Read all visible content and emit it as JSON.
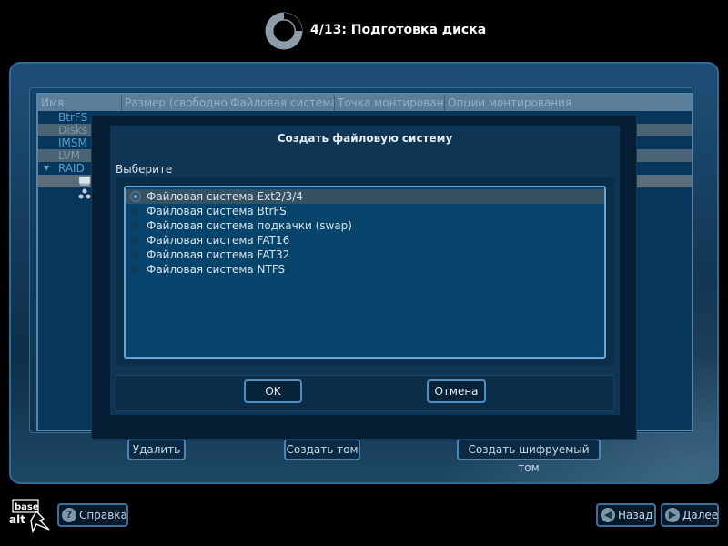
{
  "header": {
    "title": "4/13: Подготовка диска",
    "logo_icon": "basealt-ring-logo"
  },
  "table": {
    "columns": [
      "Имя",
      "Размер (свободно)",
      "Файловая система",
      "Точка монтирования",
      "Опции монтирования"
    ],
    "tree": [
      "BtrFS",
      "Disks",
      "IMSM",
      "LVM",
      "RAID"
    ]
  },
  "panel_buttons": {
    "delete": "Удалить",
    "create_volume": "Создать том",
    "create_encrypted": "Создать шифруемый том"
  },
  "dialog": {
    "title": "Создать файловую систему",
    "prompt": "Выберите",
    "options": [
      "Файловая система Ext2/3/4",
      "Файловая система BtrFS",
      "Файловая система подкачки (swap)",
      "Файловая система FAT16",
      "Файловая система FAT32",
      "Файловая система NTFS"
    ],
    "selected_index": 0,
    "ok": "OK",
    "cancel": "Отмена"
  },
  "bottom": {
    "help": "Справка",
    "back": "Назад",
    "next": "Далее",
    "brand_top": "base",
    "brand_bottom": "alt"
  },
  "colors": {
    "accent_border": "#4a90c4",
    "panel_bg": "#163e5f",
    "list_bg": "#07446c"
  }
}
